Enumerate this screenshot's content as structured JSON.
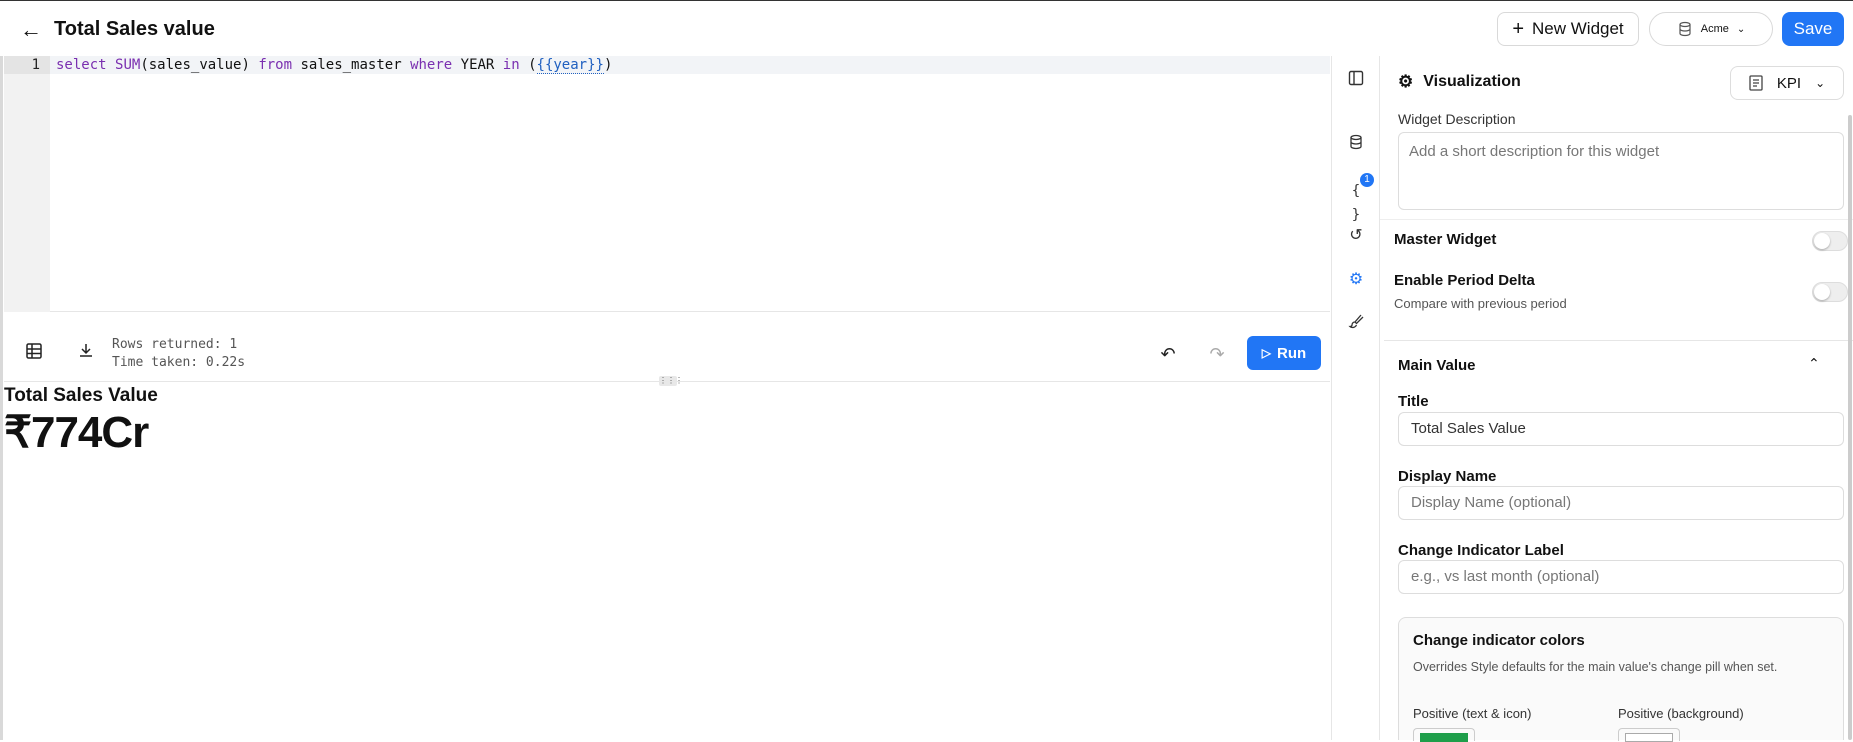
{
  "header": {
    "title": "Total Sales value",
    "new_widget_label": "New Widget",
    "datasource_label": "Acme",
    "save_label": "Save"
  },
  "editor": {
    "line_number": "1",
    "query": {
      "kw_select": "select",
      "fn_sum": "SUM",
      "args": "(sales_value) ",
      "kw_from": "from",
      "table": " sales_master ",
      "kw_where": "where",
      "col": " YEAR ",
      "kw_in": "in",
      "open": " (",
      "param": "{{year}}",
      "close": ")"
    }
  },
  "result_bar": {
    "rows_returned": "Rows returned: 1",
    "time_taken": "Time taken: 0.22s",
    "run_label": "Run"
  },
  "result": {
    "title": "Total Sales Value",
    "value": "₹774Cr"
  },
  "rail": {
    "params_badge": "1"
  },
  "panel": {
    "heading": "Visualization",
    "type_label": "KPI",
    "widget_description_label": "Widget Description",
    "widget_description_placeholder": "Add a short description for this widget",
    "master_widget_label": "Master Widget",
    "period_delta_label": "Enable Period Delta",
    "period_delta_sub": "Compare with previous period",
    "main_value_label": "Main Value",
    "title_label": "Title",
    "title_value": "Total Sales Value",
    "display_name_label": "Display Name",
    "display_name_placeholder": "Display Name (optional)",
    "change_label": "Change Indicator Label",
    "change_placeholder": "e.g., vs last month (optional)",
    "colors_heading": "Change indicator colors",
    "colors_sub": "Overrides Style defaults for the main value's change pill when set.",
    "positive_text_label": "Positive (text & icon)",
    "positive_bg_label": "Positive (background)"
  },
  "colors": {
    "accent": "#2176f5",
    "positive_text_swatch": "#1e9e4a"
  }
}
